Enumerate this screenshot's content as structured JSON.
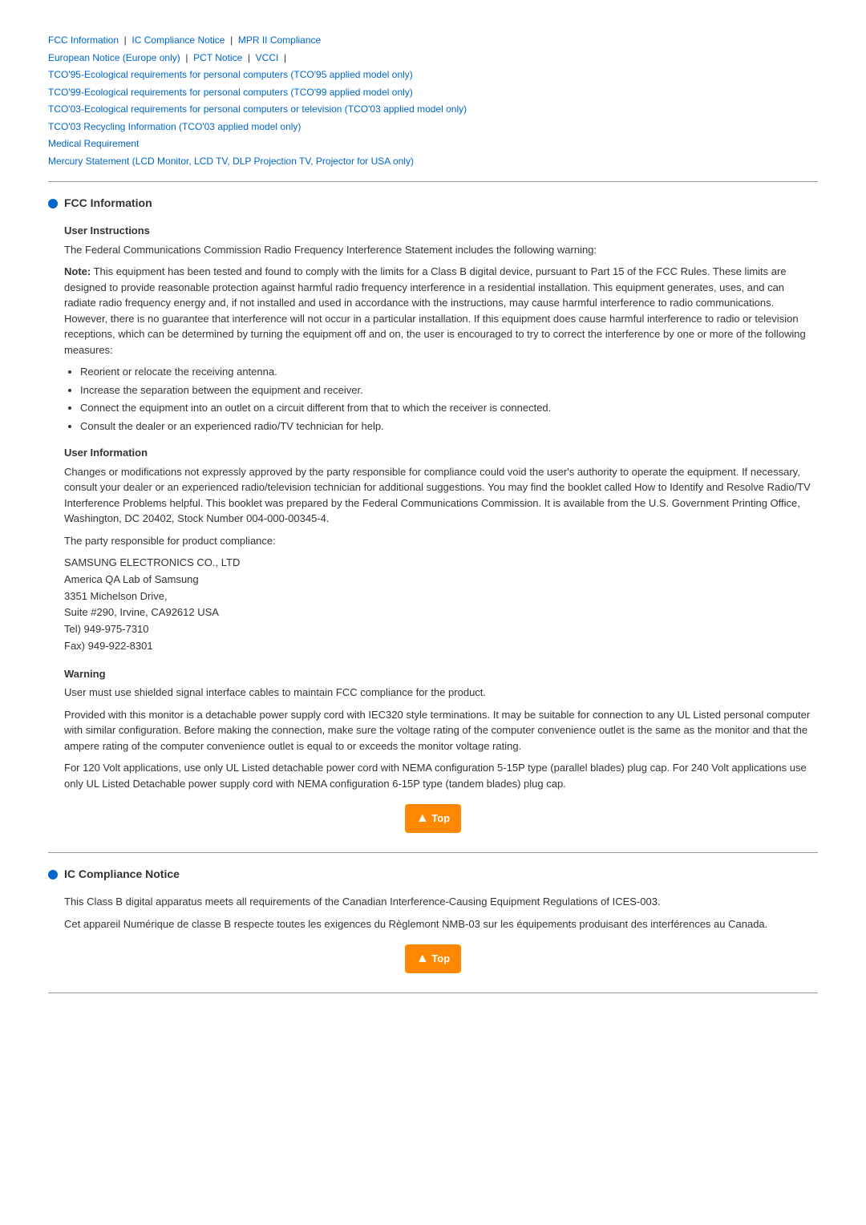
{
  "nav": {
    "line1": [
      {
        "label": "FCC Information",
        "separator": "|"
      },
      {
        "label": "IC Compliance Notice",
        "separator": "|"
      },
      {
        "label": "MPR II Compliance",
        "separator": ""
      }
    ],
    "line2": [
      {
        "label": "European Notice (Europe only)",
        "separator": "|"
      },
      {
        "label": "PCT Notice",
        "separator": "|"
      },
      {
        "label": "VCCI",
        "separator": "|"
      }
    ],
    "line3": {
      "label": "TCO'95-Ecological requirements for personal computers (TCO'95 applied model only)"
    },
    "line4": {
      "label": "TCO'99-Ecological requirements for personal computers (TCO'99 applied model only)"
    },
    "line5": {
      "label": "TCO'03-Ecological requirements for personal computers or television (TCO'03 applied model only)"
    },
    "line6": {
      "label": "TCO'03 Recycling Information (TCO'03 applied model only)"
    },
    "line7": {
      "label": "Medical Requirement"
    },
    "line8": {
      "label": "Mercury Statement (LCD Monitor, LCD TV, DLP Projection TV, Projector for USA only)"
    }
  },
  "fcc_section": {
    "title": "FCC Information",
    "user_instructions": {
      "subtitle": "User Instructions",
      "para1": "The Federal Communications Commission Radio Frequency Interference Statement includes the following warning:",
      "para2_note": "Note:",
      "para2_rest": " This equipment has been tested and found to comply with the limits for a Class B digital device, pursuant to Part 15 of the FCC Rules. These limits are designed to provide reasonable protection against harmful radio frequency interference in a residential installation. This equipment generates, uses, and can radiate radio frequency energy and, if not installed and used in accordance with the instructions, may cause harmful interference to radio communications. However, there is no guarantee that interference will not occur in a particular installation. If this equipment does cause harmful interference to radio or television receptions, which can be determined by turning the equipment off and on, the user is encouraged to try to correct the interference by one or more of the following measures:",
      "bullets": [
        "Reorient or relocate the receiving antenna.",
        "Increase the separation between the equipment and receiver.",
        "Connect the equipment into an outlet on a circuit different from that to which the receiver is connected.",
        "Consult the dealer or an experienced radio/TV technician for help."
      ]
    },
    "user_information": {
      "subtitle": "User Information",
      "para1": "Changes or modifications not expressly approved by the party responsible for compliance could void the user's authority to operate the equipment. If necessary, consult your dealer or an experienced radio/television technician for additional suggestions. You may find the booklet called How to Identify and Resolve Radio/TV Interference Problems helpful. This booklet was prepared by the Federal Communications Commission. It is available from the U.S. Government Printing Office, Washington, DC 20402, Stock Number 004-000-00345-4.",
      "para2": "The party responsible for product compliance:",
      "address_lines": [
        "SAMSUNG ELECTRONICS CO., LTD",
        "America QA Lab of Samsung",
        "3351 Michelson Drive,",
        "Suite #290, Irvine, CA92612 USA",
        "Tel) 949-975-7310",
        "Fax) 949-922-8301"
      ]
    },
    "warning": {
      "subtitle": "Warning",
      "para1": "User must use shielded signal interface cables to maintain FCC compliance for the product.",
      "para2": "Provided with this monitor is a detachable power supply cord with IEC320 style terminations. It may be suitable for connection to any UL Listed personal computer with similar configuration. Before making the connection, make sure the voltage rating of the computer convenience outlet is the same as the monitor and that the ampere rating of the computer convenience outlet is equal to or exceeds the monitor voltage rating.",
      "para3": "For 120 Volt applications, use only UL Listed detachable power cord with NEMA configuration 5-15P type (parallel blades) plug cap. For 240 Volt applications use only UL Listed Detachable power supply cord with NEMA configuration 6-15P type (tandem blades) plug cap."
    },
    "top_button": "▲ Top"
  },
  "ic_section": {
    "title": "IC Compliance Notice",
    "para1": "This Class B digital apparatus meets all requirements of the Canadian Interference-Causing Equipment Regulations of ICES-003.",
    "para2": "Cet appareil Numérique de classe B respecte toutes les exigences du Règlemont NMB-03 sur les équipements produisant des interférences au Canada.",
    "top_button": "▲ Top"
  }
}
